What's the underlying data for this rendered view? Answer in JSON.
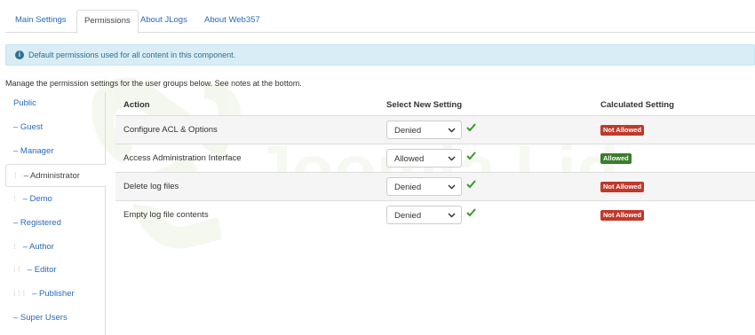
{
  "tabs": [
    {
      "label": "Main Settings"
    },
    {
      "label": "Permissions"
    },
    {
      "label": "About JLogs"
    },
    {
      "label": "About Web357"
    }
  ],
  "alert": {
    "message": "Default permissions used for all content in this component."
  },
  "intro": "Manage the permission settings for the user groups below. See notes at the bottom.",
  "groups": [
    {
      "label": "Public",
      "depth_prefix": ""
    },
    {
      "label": "– Guest",
      "depth_prefix": ""
    },
    {
      "label": "– Manager",
      "depth_prefix": ""
    },
    {
      "label": "– Administrator",
      "depth_prefix": "⁞"
    },
    {
      "label": "– Demo",
      "depth_prefix": "⁞"
    },
    {
      "label": "– Registered",
      "depth_prefix": ""
    },
    {
      "label": "– Author",
      "depth_prefix": "⁞"
    },
    {
      "label": "– Editor",
      "depth_prefix": "⁞ ⁞"
    },
    {
      "label": "– Publisher",
      "depth_prefix": "⁞ ⁞ ⁞"
    },
    {
      "label": "– Super Users",
      "depth_prefix": ""
    }
  ],
  "table": {
    "headers": {
      "action": "Action",
      "select": "Select New Setting",
      "calculated": "Calculated Setting"
    },
    "rows": [
      {
        "action": "Configure ACL & Options",
        "setting": "Denied",
        "calculated": "Not Allowed",
        "status": "bad"
      },
      {
        "action": "Access Administration Interface",
        "setting": "Allowed",
        "calculated": "Allowed",
        "status": "good"
      },
      {
        "action": "Delete log files",
        "setting": "Denied",
        "calculated": "Not Allowed",
        "status": "bad"
      },
      {
        "action": "Empty log file contents",
        "setting": "Denied",
        "calculated": "Not Allowed",
        "status": "bad"
      }
    ]
  },
  "colors": {
    "link": "#2a69b8",
    "danger": "#c0392b",
    "success": "#3a7d2c",
    "info_bg": "#d9edf7"
  }
}
